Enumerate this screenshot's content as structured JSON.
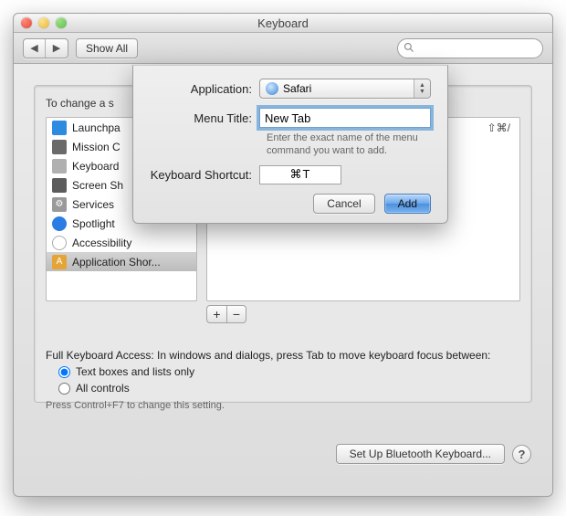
{
  "window": {
    "title": "Keyboard"
  },
  "toolbar": {
    "back_icon": "◀",
    "forward_icon": "▶",
    "show_all_label": "Show All",
    "search_placeholder": ""
  },
  "main": {
    "intro_text": "To change a s",
    "categories": [
      {
        "label": "Launchpa",
        "icon_color": "#2d8be0"
      },
      {
        "label": "Mission C",
        "icon_color": "#6a6a6a"
      },
      {
        "label": "Keyboard",
        "icon_color": "#b0b0b0"
      },
      {
        "label": "Screen Sh",
        "icon_color": "#5c5c5c"
      },
      {
        "label": "Services",
        "icon_color": "#9a9a9a"
      },
      {
        "label": "Spotlight",
        "icon_color": "#2a7de2"
      },
      {
        "label": "Accessibility",
        "icon_color": "#9a9a9a"
      },
      {
        "label": "Application Shor...",
        "icon_color": "#e5a436",
        "selected": true
      }
    ],
    "right_shortcut_display": "⇧⌘/",
    "add_label": "+",
    "remove_label": "−",
    "fka_intro": "Full Keyboard Access: In windows and dialogs, press Tab to move keyboard focus between:",
    "fka_options": [
      {
        "label": "Text boxes and lists only",
        "checked": true
      },
      {
        "label": "All controls",
        "checked": false
      }
    ],
    "fka_hint": "Press Control+F7 to change this setting.",
    "bluetooth_button": "Set Up Bluetooth Keyboard...",
    "help_label": "?"
  },
  "sheet": {
    "application_label": "Application:",
    "application_value": "Safari",
    "menu_title_label": "Menu Title:",
    "menu_title_value": "New Tab",
    "menu_title_help": "Enter the exact name of the menu command you want to add.",
    "shortcut_label": "Keyboard Shortcut:",
    "shortcut_value": "⌘T",
    "cancel_label": "Cancel",
    "add_label": "Add"
  }
}
